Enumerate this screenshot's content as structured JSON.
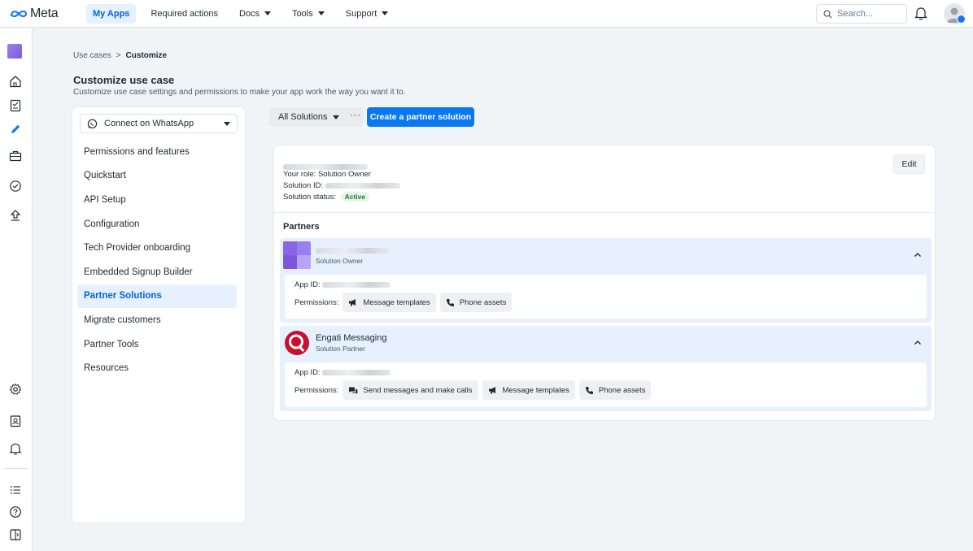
{
  "topbar": {
    "logo_text": "Meta",
    "nav": [
      {
        "label": "My Apps",
        "active": true,
        "dropdown": false
      },
      {
        "label": "Required actions",
        "active": false,
        "dropdown": false
      },
      {
        "label": "Docs",
        "active": false,
        "dropdown": true
      },
      {
        "label": "Tools",
        "active": false,
        "dropdown": true
      },
      {
        "label": "Support",
        "active": false,
        "dropdown": true
      }
    ],
    "search_placeholder": "Search..."
  },
  "breadcrumb": {
    "parent": "Use cases",
    "separator": ">",
    "current": "Customize"
  },
  "page": {
    "title": "Customize use case",
    "subtitle": "Customize use case settings and permissions to make your app work the way you want it to."
  },
  "left_panel": {
    "use_case_select": "Connect on WhatsApp",
    "menu": [
      {
        "label": "Permissions and features",
        "active": false
      },
      {
        "label": "Quickstart",
        "active": false
      },
      {
        "label": "API Setup",
        "active": false
      },
      {
        "label": "Configuration",
        "active": false
      },
      {
        "label": "Tech Provider onboarding",
        "active": false
      },
      {
        "label": "Embedded Signup Builder",
        "active": false
      },
      {
        "label": "Partner Solutions",
        "active": true
      },
      {
        "label": "Migrate customers",
        "active": false
      },
      {
        "label": "Partner Tools",
        "active": false
      },
      {
        "label": "Resources",
        "active": false
      }
    ]
  },
  "toolbar": {
    "solutions_select": "All Solutions",
    "more": "···",
    "create_button": "Create a partner solution"
  },
  "solution": {
    "role_label": "Your role:",
    "role_value": "Solution Owner",
    "id_label": "Solution ID:",
    "status_label": "Solution status:",
    "status_value": "Active",
    "edit_button": "Edit"
  },
  "partners": {
    "title": "Partners",
    "items": [
      {
        "name": "",
        "role": "Solution Owner",
        "app_id_label": "App ID:",
        "permissions_label": "Permissions:",
        "permissions": [
          {
            "icon": "megaphone-icon",
            "label": "Message templates"
          },
          {
            "icon": "phone-icon",
            "label": "Phone assets"
          }
        ]
      },
      {
        "name": "Engati Messaging",
        "role": "Solution Partner",
        "app_id_label": "App ID:",
        "permissions_label": "Permissions:",
        "permissions": [
          {
            "icon": "chat-bubbles-icon",
            "label": "Send messages and make calls"
          },
          {
            "icon": "megaphone-icon",
            "label": "Message templates"
          },
          {
            "icon": "phone-icon",
            "label": "Phone assets"
          }
        ]
      }
    ]
  },
  "colors": {
    "accent": "#0064e0",
    "primary_button": "#0a78f0",
    "active_bg": "#e7f0fd",
    "status_active": "#1a7a36"
  }
}
